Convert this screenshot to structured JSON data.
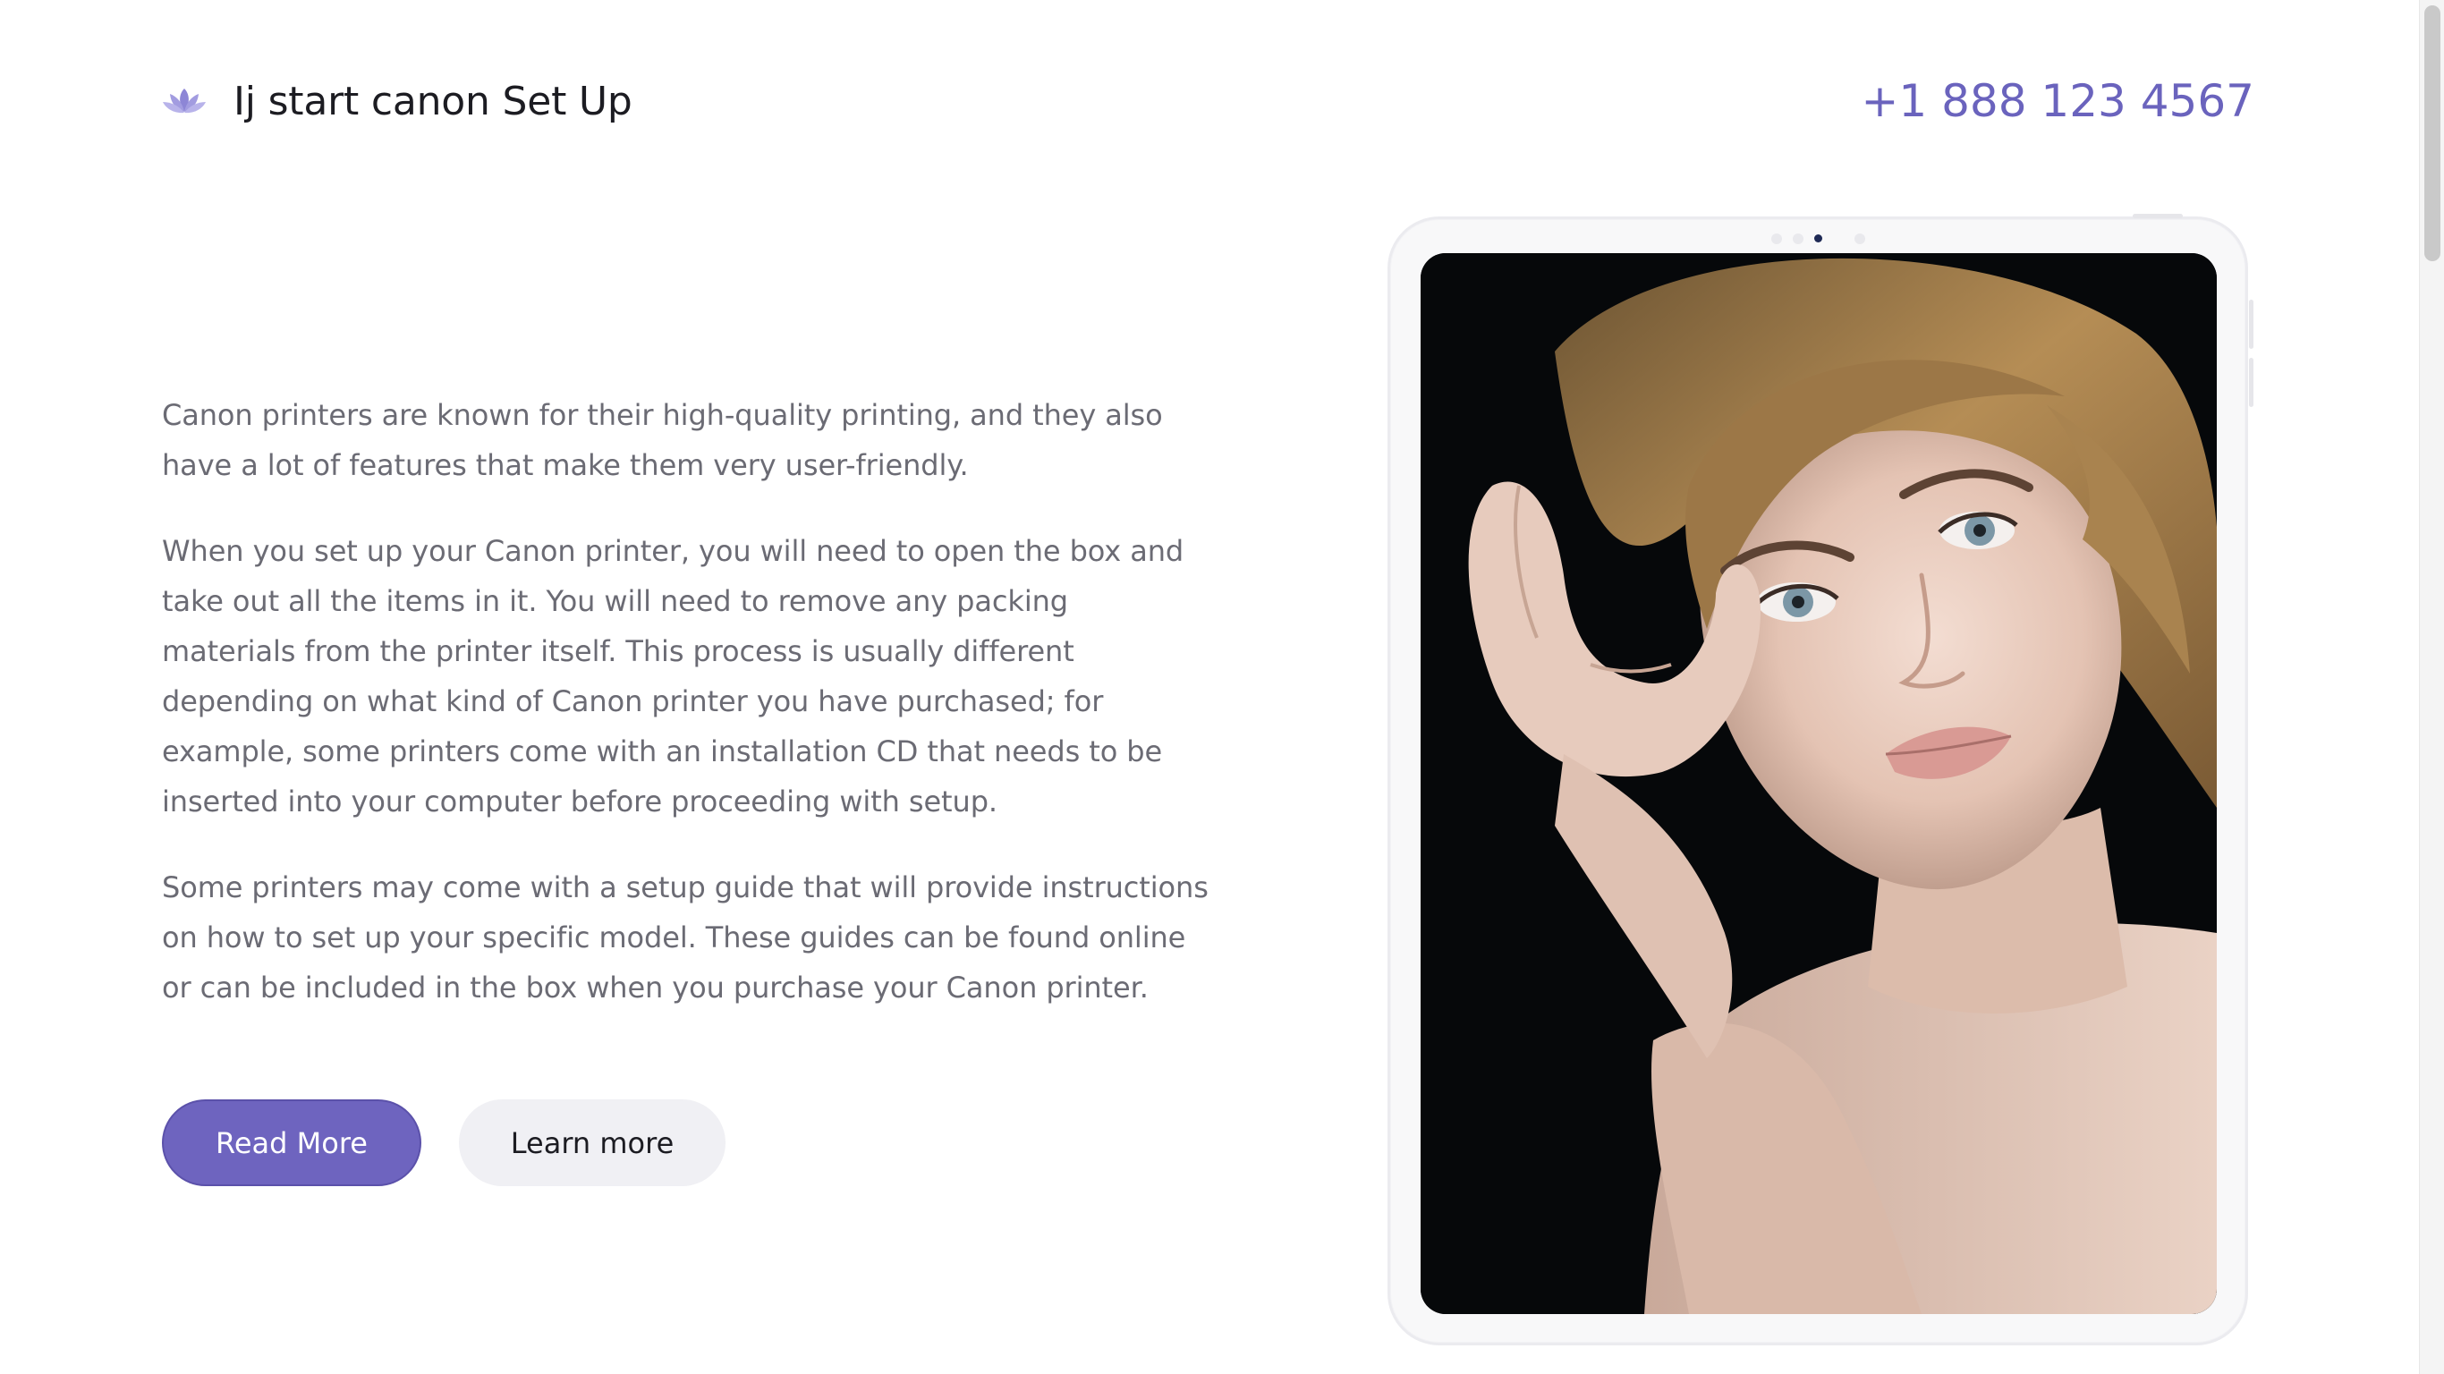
{
  "header": {
    "logo_icon": "lotus-icon",
    "title": "Ij start canon Set Up",
    "phone": "+1 888 123 4567"
  },
  "content": {
    "paragraphs": [
      "Canon printers are known for their high-quality printing, and they also have a lot of features that make them very user-friendly.",
      "When you set up your Canon printer, you will need to open the box and take out all the items in it. You will need to remove any packing materials from the printer itself. This process is usually different depending on what kind of Canon printer you have purchased; for example, some printers come with an installation CD that needs to be inserted into your computer before proceeding with setup.",
      "Some printers may come with a setup guide that will provide instructions on how to set up your specific model. These guides can be found online or can be included in the box when you purchase your Canon printer."
    ]
  },
  "buttons": {
    "primary_label": "Read More",
    "secondary_label": "Learn more"
  },
  "hero": {
    "device": "tablet-mockup",
    "image_subject": "portrait"
  },
  "colors": {
    "accent": "#6e64bf",
    "phone": "#6a63bd",
    "body_text": "#6b6b74",
    "heading": "#1c1c22",
    "secondary_button_bg": "#f0f0f4"
  }
}
